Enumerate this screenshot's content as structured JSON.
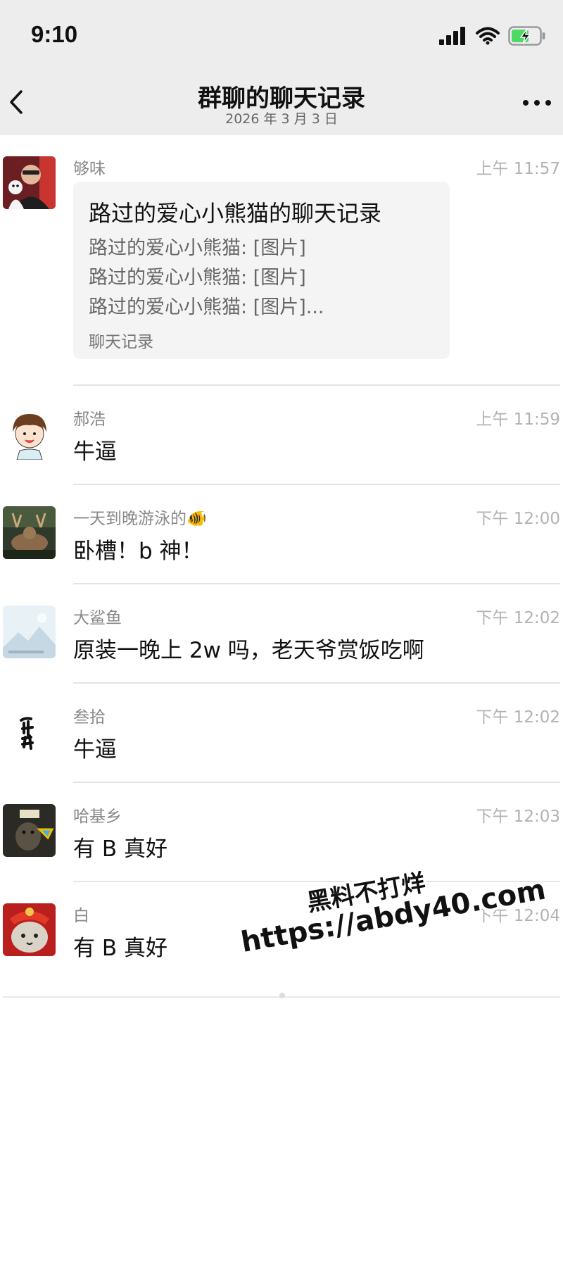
{
  "status_bar": {
    "time": "9:10"
  },
  "nav": {
    "title": "群聊的聊天记录",
    "subtitle": "2026 年 3 月 3 日"
  },
  "messages": [
    {
      "sender": "够味",
      "time": "上午 11:57",
      "type": "card",
      "card": {
        "title": "路过的爱心小熊猫的聊天记录",
        "lines": [
          "路过的爱心小熊猫: [图片]",
          "路过的爱心小熊猫: [图片]",
          "路过的爱心小熊猫: [图片]..."
        ],
        "footer": "聊天记录"
      }
    },
    {
      "sender": "郝浩",
      "time": "上午 11:59",
      "text": "牛逼"
    },
    {
      "sender": "一天到晚游泳的🐠",
      "time": "下午 12:00",
      "text": "卧槽！b 神！"
    },
    {
      "sender": "大鲨鱼",
      "time": "下午 12:02",
      "text": "原装一晚上 2w 吗，老天爷赏饭吃啊"
    },
    {
      "sender": "叁拾",
      "time": "下午 12:02",
      "text": "牛逼"
    },
    {
      "sender": "哈基乡",
      "time": "下午 12:03",
      "text": "有 B 真好"
    },
    {
      "sender": "白",
      "time": "下午 12:04",
      "text": "有 B 真好"
    }
  ],
  "watermark": {
    "line1": "黑料不打烊",
    "line2": "https://abdy40.com"
  },
  "colors": {
    "header_bg": "#ededed",
    "card_bg": "#f4f4f4",
    "time_text": "#b2b2b2"
  }
}
